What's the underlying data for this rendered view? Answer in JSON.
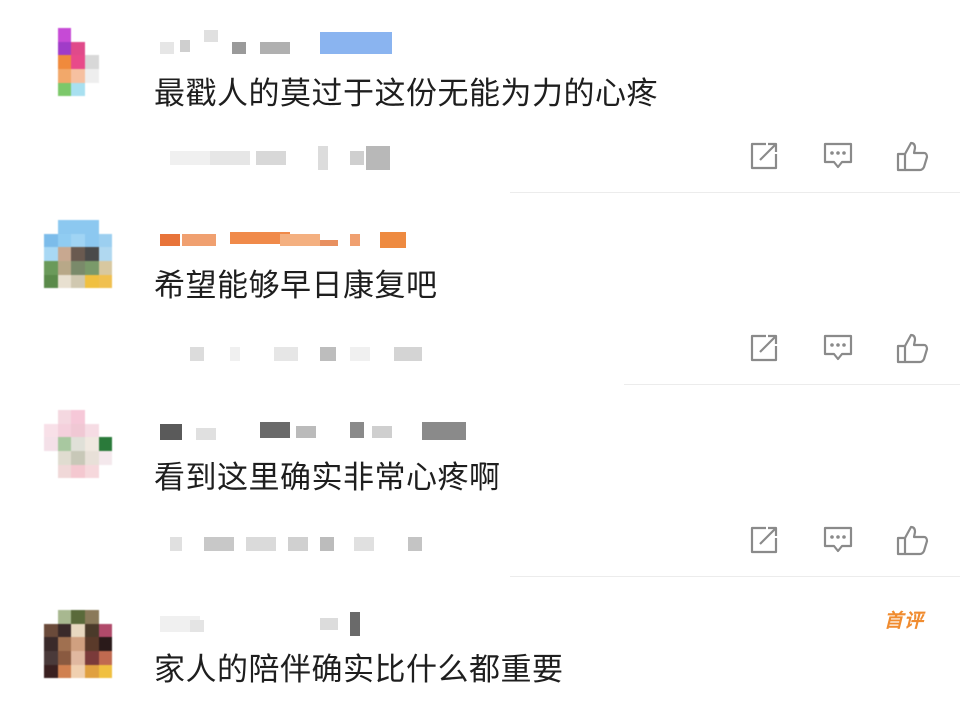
{
  "comments": [
    {
      "text": "最戳人的莫过于这份无能为力的心疼"
    },
    {
      "text": "希望能够早日康复吧"
    },
    {
      "text": "看到这里确实非常心疼啊"
    },
    {
      "text": "家人的陪伴确实比什么都重要",
      "badge": "首评"
    }
  ],
  "icons": {
    "share": "share-icon",
    "reply": "reply-icon",
    "like": "thumbs-up-icon"
  },
  "colors": {
    "text": "#1e1e1e",
    "icon": "#8a8a8a",
    "badge": "#f08c30",
    "divider": "#ececec"
  }
}
